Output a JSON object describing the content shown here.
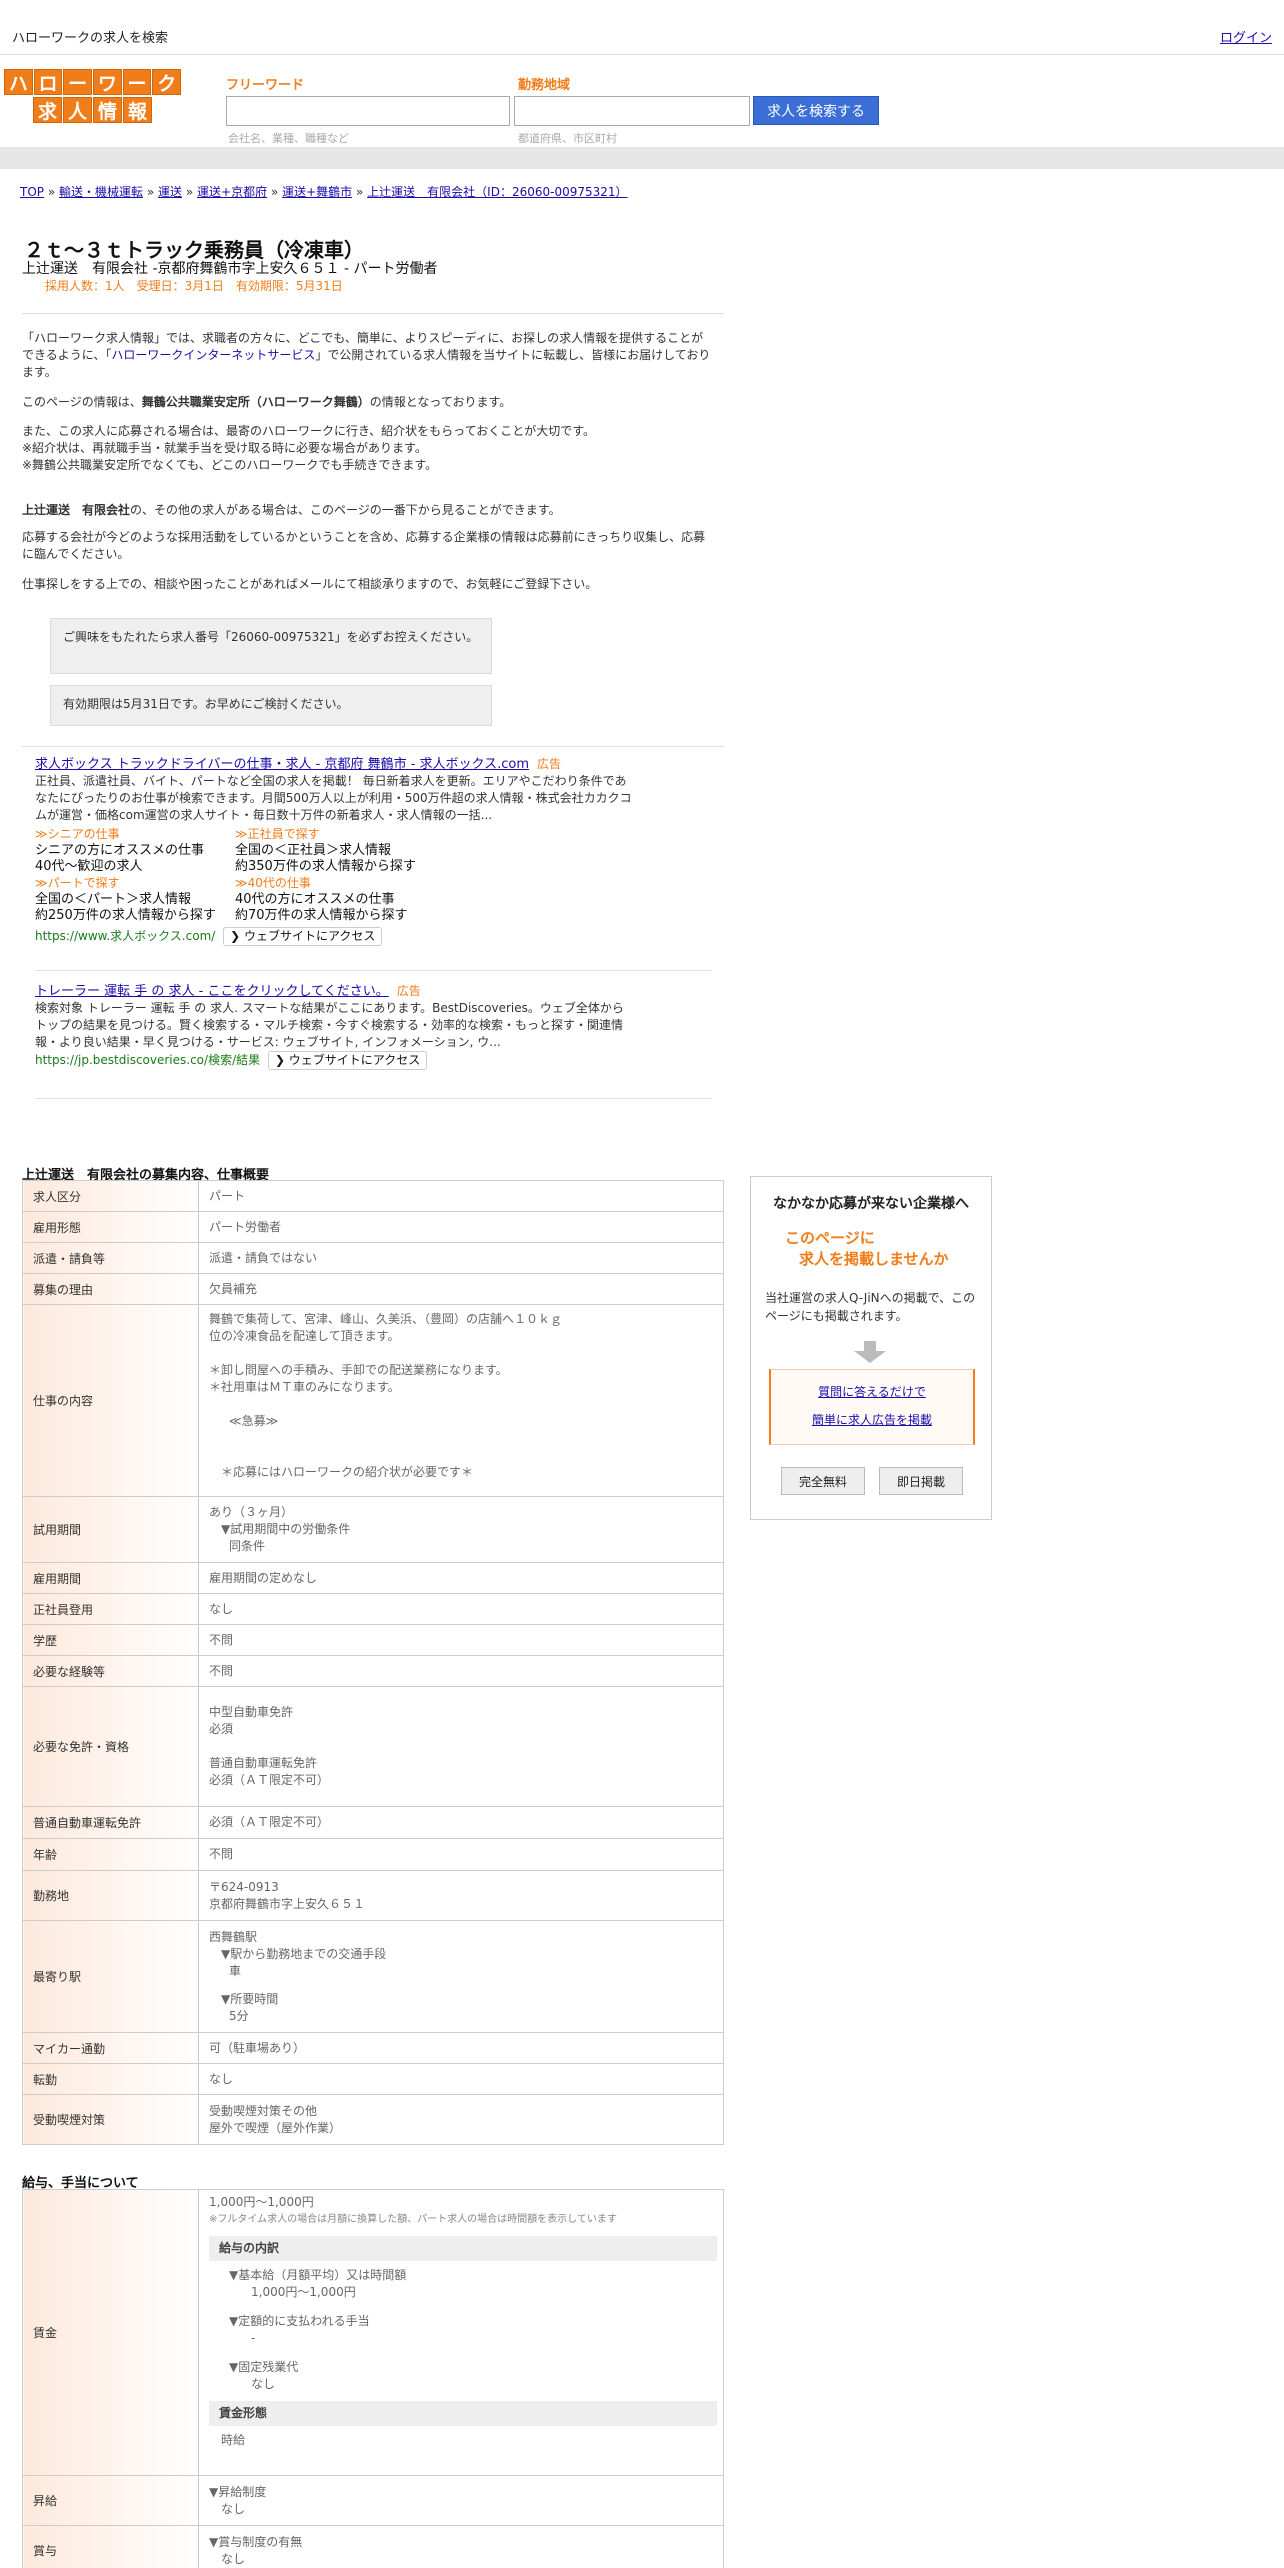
{
  "topbar": {
    "site_title": "ハローワークの求人を検索",
    "login": "ログイン"
  },
  "header": {
    "logo_row1": [
      "ハ",
      "ロ",
      "ー",
      "ワ",
      "ー",
      "ク"
    ],
    "logo_row2": [
      "求",
      "人",
      "情",
      "報"
    ],
    "keyword_label": "フリーワード",
    "keyword_hint": "会社名、業種、職種など",
    "area_label": "勤務地域",
    "area_hint": "都道府県、市区町村",
    "search_button": "求人を検索する"
  },
  "breadcrumb": {
    "items": [
      "TOP",
      "輸送・機械運転",
      "運送",
      "運送+京都府",
      "運送+舞鶴市",
      "上辻運送　有限会社（ID：26060-00975321）"
    ],
    "separator": "»"
  },
  "job": {
    "title": "２ｔ～３ｔトラック乗務員（冷凍車）",
    "company_line": "上辻運送　有限会社 -京都府舞鶴市字上安久６５１ - パート労働者",
    "meta": "採用人数：1人　受理日：3月1日　有効期限：5月31日"
  },
  "intro": {
    "p1a": "「ハローワーク求人情報」では、求職者の方々に、どこでも、簡単に、よりスピーディに、お探しの求人情報を提供することができるように、「",
    "p1_link": "ハローワークインターネットサービス",
    "p1b": "」で公開されている求人情報を当サイトに転載し、皆様にお届けしております。",
    "p2a": "このページの情報は、",
    "p2_bold": "舞鶴公共職業安定所（ハローワーク舞鶴）",
    "p2b": "の情報となっております。",
    "p3_1": "また、この求人に応募される場合は、最寄のハローワークに行き、紹介状をもらっておくことが大切です。",
    "p3_2": "※紹介状は、再就職手当・就業手当を受け取る時に必要な場合があります。",
    "p3_3": "※舞鶴公共職業安定所でなくても、どこのハローワークでも手続きできます。",
    "p4_bold": "上辻運送　有限会社",
    "p4": "の、その他の求人がある場合は、このページの一番下から見ることができます。",
    "p5": "応募する会社が今どのような採用活動をしているかということを含め、応募する企業様の情報は応募前にきっちり収集し、応募に臨んでください。",
    "p6": "仕事探しをする上での、相談や困ったことがあればメールにて相談承りますので、お気軽にご登録下さい。"
  },
  "notices": {
    "n1": "ご興味をもたれたら求人番号「26060-00975321」を必ずお控えください。",
    "n2": "有効期限は5月31日です。お早めにご検討ください。"
  },
  "ads": [
    {
      "title": "求人ボックス トラックドライバーの仕事・求人 - 京都府 舞鶴市 - 求人ボックス.com",
      "badge": "広告",
      "desc": "正社員、派遣社員、バイト、パートなど全国の求人を掲載！ 毎日新着求人を更新。エリアやこだわり条件であなたにぴったりのお仕事が検索できます。月間500万人以上が利用・500万件超の求人情報・株式会社カカクコムが運営・価格com運営の求人サイト・毎日数十万件の新着求人・求人情報の一括...",
      "sitelinks": [
        {
          "title": "≫シニアの仕事",
          "l1": "シニアの方にオススメの仕事",
          "l2": "40代～歓迎の求人"
        },
        {
          "title": "≫正社員で探す",
          "l1": "全国の＜正社員＞求人情報",
          "l2": "約350万件の求人情報から探す"
        },
        {
          "title": "≫パートで探す",
          "l1": "全国の＜パート＞求人情報",
          "l2": "約250万件の求人情報から探す"
        },
        {
          "title": "≫40代の仕事",
          "l1": "40代の方にオススメの仕事",
          "l2": "約70万件の求人情報から探す"
        }
      ],
      "url": "https://www.求人ボックス.com/",
      "visit": "❯ ウェブサイトにアクセス"
    },
    {
      "title": "トレーラー 運転 手 の 求人 - ここをクリックしてください。",
      "badge": "広告",
      "desc": "検索対象 トレーラー 運転 手 の 求人. スマートな結果がここにあります。BestDiscoveries。ウェブ全体からトップの結果を見つける。賢く検索する・マルチ検索・今すぐ検索する・効率的な検索・もっと探す・関連情報・より良い結果・早く見つける・サービス: ウェブサイト, インフォメーション, ウ...",
      "url": "https://jp.bestdiscoveries.co/検索/結果",
      "visit": "❯ ウェブサイトにアクセス"
    }
  ],
  "recruit_section": {
    "heading": "上辻運送　有限会社の募集内容、仕事概要",
    "rows": {
      "kyujin_kubun": {
        "label": "求人区分",
        "value": "パート"
      },
      "koyo_keitai": {
        "label": "雇用形態",
        "value": "パート労働者"
      },
      "haken": {
        "label": "派遣・請負等",
        "value": "派遣・請負ではない"
      },
      "riyu": {
        "label": "募集の理由",
        "value": "欠員補充"
      },
      "shigoto": {
        "label": "仕事の内容",
        "l1": "舞鶴で集荷して、宮津、峰山、久美浜、（豊岡）の店舗へ１０ｋｇ",
        "l2": "位の冷凍食品を配達して頂きます。",
        "l3": "＊卸し問屋への手積み、手卸での配送業務になります。",
        "l4": "＊社用車はＭＴ車のみになります。",
        "l5": "≪急募≫",
        "l6": "＊応募にはハローワークの紹介状が必要です＊"
      },
      "shiyo": {
        "label": "試用期間",
        "l1": "あり（３ヶ月）",
        "l2": "▼試用期間中の労働条件",
        "l3": "同条件"
      },
      "koyo_kikan": {
        "label": "雇用期間",
        "value": "雇用期間の定めなし"
      },
      "seishain": {
        "label": "正社員登用",
        "value": "なし"
      },
      "gakureki": {
        "label": "学歴",
        "value": "不問"
      },
      "keiken": {
        "label": "必要な経験等",
        "value": "不問"
      },
      "menkyo": {
        "label": "必要な免許・資格",
        "l1": "中型自動車免許",
        "l2": "必須",
        "l3": "普通自動車運転免許",
        "l4": "必須（ＡＴ限定不可）"
      },
      "futsu": {
        "label": "普通自動車運転免許",
        "value": "必須（ＡＴ限定不可）"
      },
      "nenrei": {
        "label": "年齢",
        "value": "不問"
      },
      "kinmuchi": {
        "label": "勤務地",
        "l1": "〒624-0913",
        "l2": "京都府舞鶴市字上安久６５１"
      },
      "eki": {
        "label": "最寄り駅",
        "l1": "西舞鶴駅",
        "l2": "▼駅から勤務地までの交通手段",
        "l3": "車",
        "l4": "▼所要時間",
        "l5": "5分"
      },
      "mycar": {
        "label": "マイカー通勤",
        "value": "可（駐車場あり）"
      },
      "tenkin": {
        "label": "転勤",
        "value": "なし"
      },
      "kitsuen": {
        "label": "受動喫煙対策",
        "l1": "受動喫煙対策その他",
        "l2": "屋外で喫煙（屋外作業）"
      }
    }
  },
  "salary_section": {
    "heading": "給与、手当について",
    "wage": {
      "label": "賃金",
      "range": "1,000円〜1,000円",
      "note": "※フルタイム求人の場合は月額に換算した額、パート求人の場合は時間額を表示しています",
      "breakdown_title": "給与の内訳",
      "b1": "▼基本給（月額平均）又は時間額",
      "b1v": "1,000円〜1,000円",
      "b2": "▼定額的に支払われる手当",
      "b2v": "-",
      "b3": "▼固定残業代",
      "b3v": "なし",
      "form_title": "賃金形態",
      "form_value": "時給"
    },
    "shokyu": {
      "label": "昇給",
      "l1": "▼昇給制度",
      "l2": "なし"
    },
    "shoyo": {
      "label": "賞与",
      "l1": "▼賞与制度の有無",
      "l2": "なし"
    }
  },
  "side_panel": {
    "title": "なかなか応募が来ない企業様へ",
    "catch1": "このページに",
    "catch2": "求人を掲載しませんか",
    "desc": "当社運営の求人Q-JiNへの掲載で、このページにも掲載されます。",
    "link1": "質問に答えるだけで",
    "link2": "簡単に求人広告を掲載",
    "tag1": "完全無料",
    "tag2": "即日掲載"
  },
  "colors": {
    "accent_orange": "#f07d1a",
    "search_blue": "#3b6fd6",
    "link": "#1a0dab",
    "ad_url_green": "#1a7a1a"
  }
}
